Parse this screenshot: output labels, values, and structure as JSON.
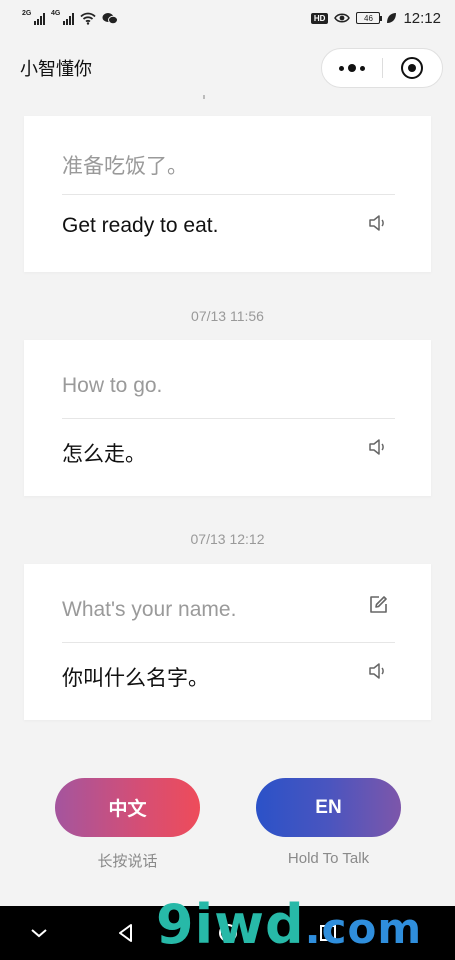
{
  "status_bar": {
    "net1_gen": "2G",
    "net2_gen": "4G",
    "hd_badge": "HD",
    "battery": "46",
    "time": "12:12"
  },
  "nav": {
    "title": "小智懂你"
  },
  "conversations": [
    {
      "timestamp": "",
      "source_text": "准备吃饭了。",
      "target_text": "Get ready to eat.",
      "editable": false
    },
    {
      "timestamp": "07/13 11:56",
      "source_text": "How to go.",
      "target_text": "怎么走。",
      "editable": false
    },
    {
      "timestamp": "07/13 12:12",
      "source_text": "What's your name.",
      "target_text": "你叫什么名字。",
      "editable": true
    }
  ],
  "controls": {
    "chinese_button": "中文",
    "chinese_hint": "长按说话",
    "english_button": "EN",
    "english_hint": "Hold To Talk"
  },
  "watermark": {
    "main": "9iwd",
    "suffix": ".com"
  },
  "colors": {
    "background": "#f3f3f3",
    "chinese_gradient_start": "#a4559e",
    "chinese_gradient_end": "#ee4c5a",
    "english_gradient_start": "#2b52c8",
    "english_gradient_end": "#7d56aa"
  }
}
